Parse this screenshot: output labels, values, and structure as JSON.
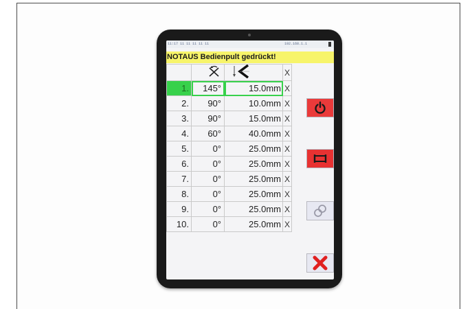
{
  "status_bar": {
    "left_text": "11:17 11 11 11 11 11",
    "right_text": "192.168.1.1"
  },
  "alert": {
    "text": "NOTAUS Bedienpult gedrückt!"
  },
  "table": {
    "header_angle_icon": "bend-angle-icon",
    "header_length_icon": "bend-length-icon",
    "delete_label": "X",
    "rows": [
      {
        "index": "1.",
        "angle": "145°",
        "length": "15.0mm",
        "active": true
      },
      {
        "index": "2.",
        "angle": "90°",
        "length": "10.0mm"
      },
      {
        "index": "3.",
        "angle": "90°",
        "length": "15.0mm"
      },
      {
        "index": "4.",
        "angle": "60°",
        "length": "40.0mm"
      },
      {
        "index": "5.",
        "angle": "0°",
        "length": "25.0mm"
      },
      {
        "index": "6.",
        "angle": "0°",
        "length": "25.0mm"
      },
      {
        "index": "7.",
        "angle": "0°",
        "length": "25.0mm"
      },
      {
        "index": "8.",
        "angle": "0°",
        "length": "25.0mm"
      },
      {
        "index": "9.",
        "angle": "0°",
        "length": "25.0mm"
      },
      {
        "index": "10.",
        "angle": "0°",
        "length": "25.0mm"
      }
    ]
  },
  "buttons": {
    "power_icon": "power-icon",
    "flag_icon": "flag-icon",
    "link_icon": "chain-link-icon",
    "cancel_icon": "cancel-x-icon"
  },
  "colors": {
    "alert_bg": "#f7f46a",
    "active_row": "#37d14b",
    "red_button": "#ea3a3a",
    "cancel_x": "#e02020"
  }
}
